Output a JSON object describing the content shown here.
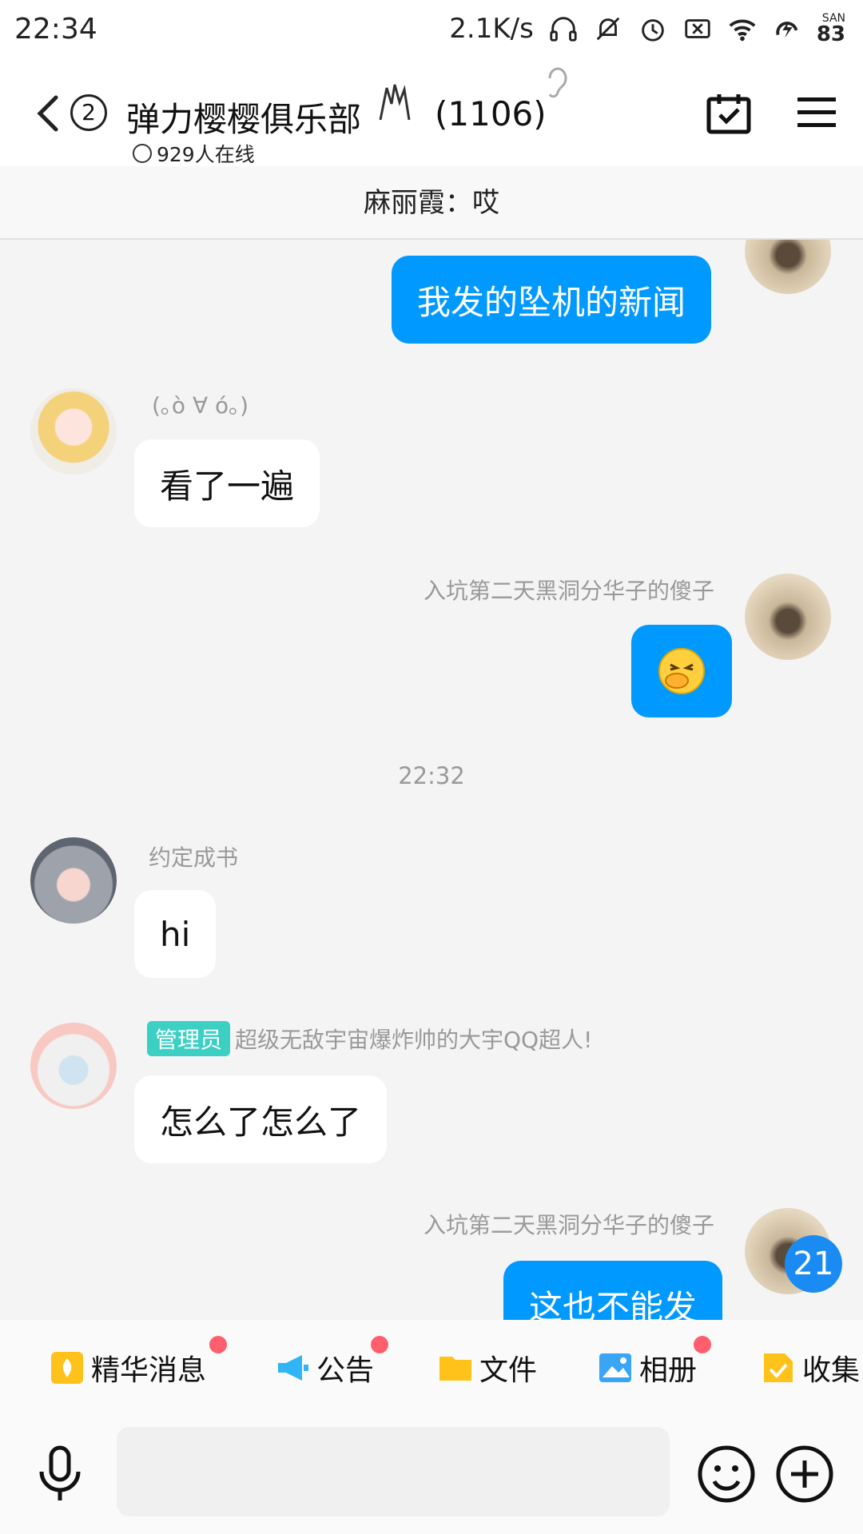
{
  "status_bar": {
    "time": "22:34",
    "speed": "2.1K/s",
    "battery_label": "SAN",
    "battery": "83"
  },
  "header": {
    "unread_count": "2",
    "group_name": "弹力樱樱俱乐部",
    "member_count": "(1106)",
    "online_text": "929人在线"
  },
  "banner": {
    "text": "麻丽霞：哎"
  },
  "messages": [
    {
      "direction": "out",
      "sender": "",
      "text": "我发的坠机的新闻"
    },
    {
      "direction": "in",
      "sender": "(｡ò ∀ ó｡)",
      "text": "看了一遍"
    },
    {
      "direction": "out",
      "sender": "入坑第二天黑洞分华子的傻子",
      "text": "",
      "emoji": "face-covering-mouth-emoji"
    },
    {
      "timestamp": "22:32"
    },
    {
      "direction": "in",
      "sender": "约定成书",
      "text": "hi"
    },
    {
      "direction": "in",
      "sender": "超级无敌宇宙爆炸帅的大宇QQ超人!",
      "badge": "管理员",
      "text": "怎么了怎么了"
    },
    {
      "direction": "out",
      "sender": "入坑第二天黑洞分华子的傻子",
      "text": "这也不能发"
    }
  ],
  "unread_bubble": "21",
  "tools": [
    {
      "label": "精华消息",
      "icon": "essence-icon",
      "dot": true
    },
    {
      "label": "公告",
      "icon": "announcement-icon",
      "dot": true
    },
    {
      "label": "文件",
      "icon": "folder-icon",
      "dot": false
    },
    {
      "label": "相册",
      "icon": "album-icon",
      "dot": true
    },
    {
      "label": "收集",
      "icon": "collect-icon",
      "dot": false
    }
  ],
  "colors": {
    "accent": "#0099ff",
    "admin_badge": "#3ccfc4",
    "red_dot": "#ff5f6d"
  }
}
